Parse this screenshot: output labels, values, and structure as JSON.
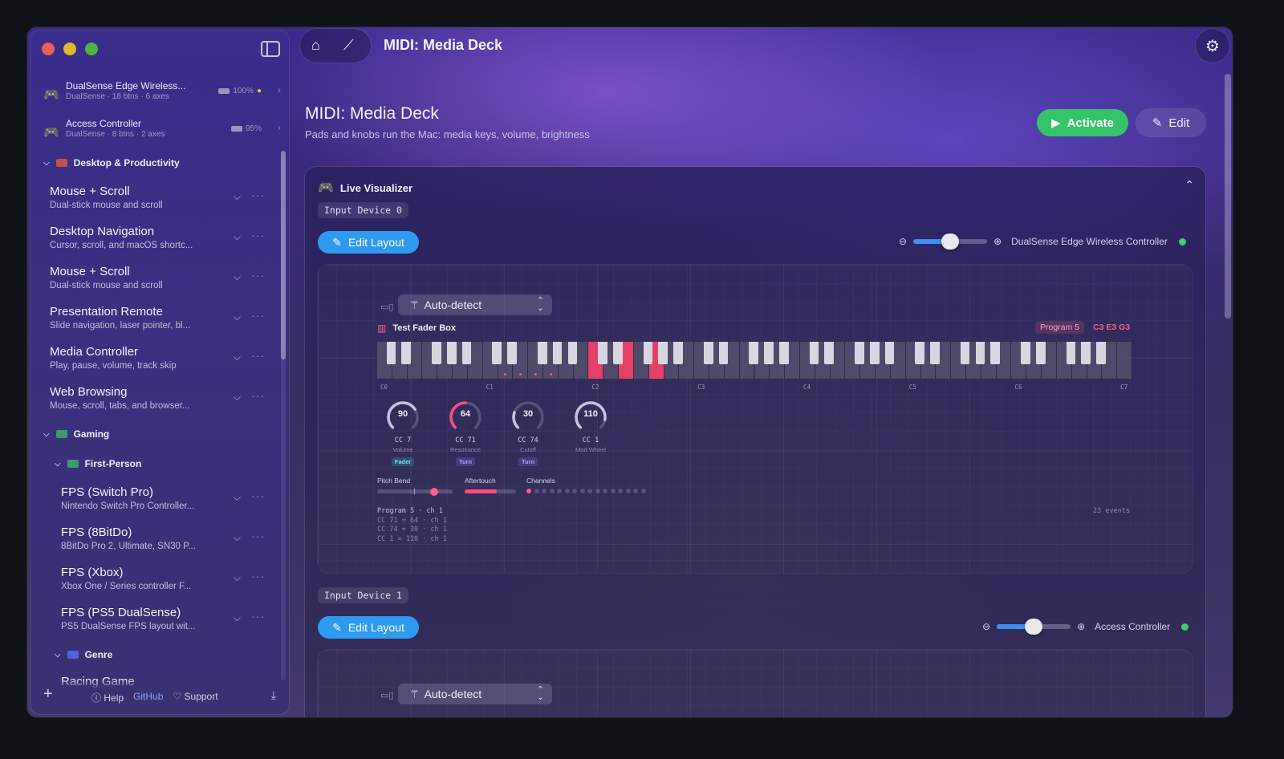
{
  "window": {
    "title": "MIDI: Media Deck"
  },
  "sidebar": {
    "devices": [
      {
        "name": "DualSense Edge Wireless...",
        "sub": "DualSense · 18 btns · 6 axes",
        "battery": "100%"
      },
      {
        "name": "Access Controller",
        "sub": "DualSense · 8 btns · 2 axes",
        "battery": "95%"
      }
    ],
    "groups": [
      {
        "label": "Desktop & Productivity"
      },
      {
        "label": "Gaming"
      },
      {
        "label": "First-Person"
      },
      {
        "label": "Genre"
      }
    ],
    "profiles": [
      {
        "title": "Mouse + Scroll",
        "sub": "Dual-stick mouse and scroll"
      },
      {
        "title": "Desktop Navigation",
        "sub": "Cursor, scroll, and macOS shortc..."
      },
      {
        "title": "Mouse + Scroll",
        "sub": "Dual-stick mouse and scroll"
      },
      {
        "title": "Presentation Remote",
        "sub": "Slide navigation, laser pointer, bl..."
      },
      {
        "title": "Media Controller",
        "sub": "Play, pause, volume, track skip"
      },
      {
        "title": "Web Browsing",
        "sub": "Mouse, scroll, tabs, and browser..."
      },
      {
        "title": "FPS (Switch Pro)",
        "sub": "Nintendo Switch Pro Controller..."
      },
      {
        "title": "FPS (8BitDo)",
        "sub": "8BitDo Pro 2, Ultimate, SN30 P..."
      },
      {
        "title": "FPS (Xbox)",
        "sub": "Xbox One / Series controller F..."
      },
      {
        "title": "FPS (PS5 DualSense)",
        "sub": "PS5 DualSense FPS layout wit..."
      },
      {
        "title": "Racing Game",
        "sub": ""
      }
    ],
    "footer": {
      "help": "Help",
      "github": "GitHub",
      "support": "Support"
    }
  },
  "main": {
    "title": "MIDI: Media Deck",
    "subtitle": "Pads and knobs run the Mac: media keys, volume, brightness",
    "activate_label": "Activate",
    "edit_label": "Edit",
    "visualizer": {
      "title": "Live Visualizer",
      "devices": [
        {
          "tag": "Input Device 0",
          "edit_layout": "Edit Layout",
          "zoom": 0.5,
          "controller": "DualSense Edge Wireless Controller",
          "mode": "Auto-detect"
        },
        {
          "tag": "Input Device 1",
          "edit_layout": "Edit Layout",
          "zoom": 0.5,
          "controller": "Access Controller",
          "mode": "Auto-detect"
        }
      ],
      "midi": {
        "name": "Test Fader Box",
        "program": "Program 5",
        "notes": "C3 E3 G3",
        "octaves": [
          "C0",
          "C1",
          "C2",
          "C3",
          "C4",
          "C5",
          "C6",
          "C7"
        ],
        "knobs": [
          {
            "value": "90",
            "cc": "CC 7",
            "name": "Volume",
            "mode": "Fader",
            "level": 0.71
          },
          {
            "value": "64",
            "cc": "CC 71",
            "name": "Resonance",
            "mode": "Turn",
            "level": 0.5
          },
          {
            "value": "30",
            "cc": "CC 74",
            "name": "Cutoff",
            "mode": "Turn",
            "level": 0.24
          },
          {
            "value": "110",
            "cc": "CC 1",
            "name": "Mod Wheel",
            "mode": "",
            "level": 0.87
          }
        ],
        "pitch_bend_label": "Pitch Bend",
        "pitch_bend": 0.75,
        "aftertouch_label": "Aftertouch",
        "aftertouch": 0.62,
        "channels_label": "Channels",
        "log": [
          "Program 5 · ch 1",
          "CC 71 = 64 · ch 1",
          "CC 74 = 30 · ch 1",
          "CC 1 = 110 · ch 1"
        ],
        "events": "23 events"
      }
    }
  },
  "colors": {
    "accent_blue": "#2e9bf0",
    "activate_green": "#36c46a",
    "midi_pink": "#ff4d7a"
  }
}
